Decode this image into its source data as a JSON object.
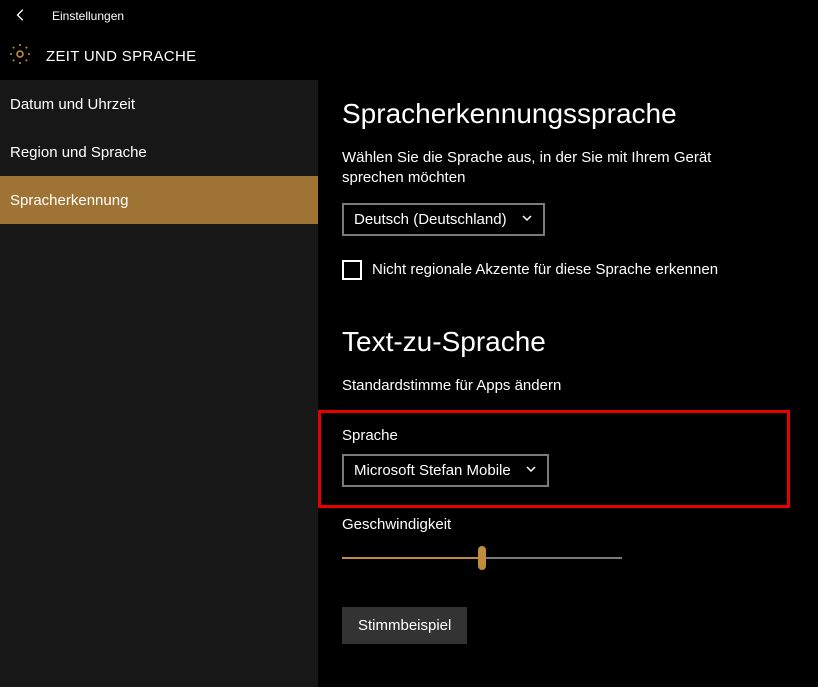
{
  "titlebar": {
    "title": "Einstellungen"
  },
  "header": {
    "title": "ZEIT UND SPRACHE"
  },
  "sidebar": {
    "items": [
      {
        "label": "Datum und Uhrzeit"
      },
      {
        "label": "Region und Sprache"
      },
      {
        "label": "Spracherkennung"
      }
    ]
  },
  "section1": {
    "title": "Spracherkennungssprache",
    "desc": "Wählen Sie die Sprache aus, in der Sie mit Ihrem Gerät sprechen möchten",
    "select_value": "Deutsch (Deutschland)",
    "checkbox_label": "Nicht regionale Akzente für diese Sprache erkennen"
  },
  "section2": {
    "title": "Text-zu-Sprache",
    "desc": "Standardstimme für Apps ändern",
    "voice_label": "Sprache",
    "voice_value": "Microsoft Stefan Mobile",
    "speed_label": "Geschwindigkeit",
    "button": "Stimmbeispiel"
  }
}
